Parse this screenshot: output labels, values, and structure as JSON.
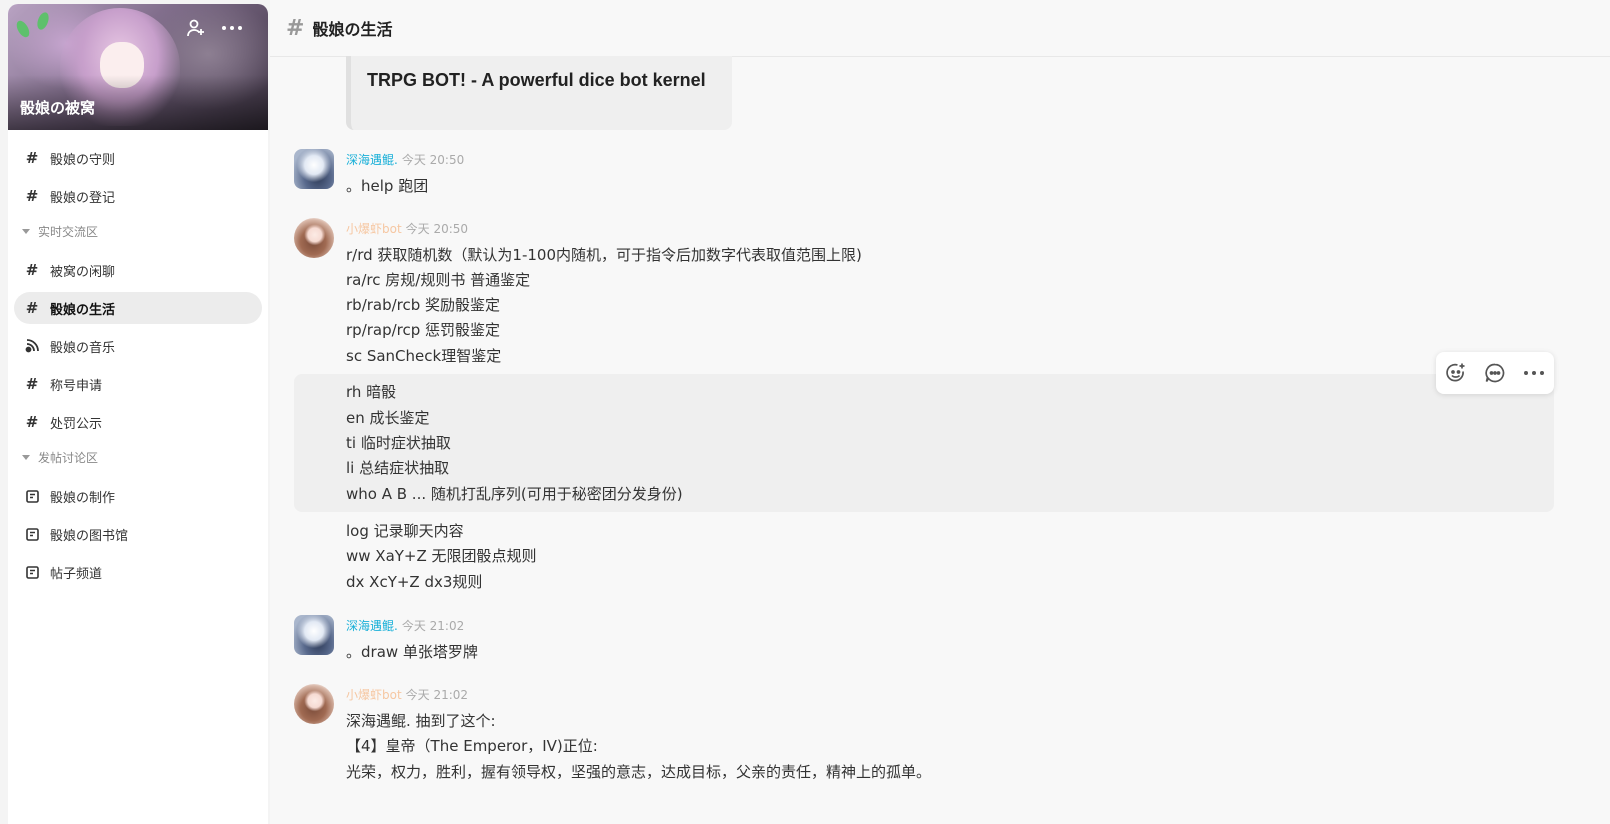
{
  "server": {
    "name": "骰娘の被窝"
  },
  "sidebar": {
    "channels_top": [
      {
        "label": "骰娘の守则",
        "icon": "hash-icon"
      },
      {
        "label": "骰娘の登记",
        "icon": "hash-icon"
      }
    ],
    "category_realtime": "实时交流区",
    "channels_realtime": [
      {
        "label": "被窝の闲聊",
        "icon": "hash-icon"
      },
      {
        "label": "骰娘の生活",
        "icon": "hash-icon",
        "active": true
      },
      {
        "label": "骰娘の音乐",
        "icon": "music-icon"
      },
      {
        "label": "称号申请",
        "icon": "hash-icon"
      },
      {
        "label": "处罚公示",
        "icon": "hash-icon"
      }
    ],
    "category_forum": "发帖讨论区",
    "channels_forum": [
      {
        "label": "骰娘の制作",
        "icon": "post-icon"
      },
      {
        "label": "骰娘の图书馆",
        "icon": "post-icon"
      },
      {
        "label": "帖子频道",
        "icon": "post-icon"
      }
    ]
  },
  "header": {
    "channel_name": "骰娘の生活"
  },
  "embed": {
    "title": "TRPG BOT! - A powerful dice bot kernel"
  },
  "messages": [
    {
      "author": "深海遇鲲.",
      "time": "今天 20:50",
      "lines": [
        "。help 跑团"
      ]
    },
    {
      "author": "小爆虾bot",
      "time": "今天 20:50",
      "lines": [
        "r/rd 获取随机数（默认为1-100内随机，可于指令后加数字代表取值范围上限)",
        "ra/rc 房规/规则书 普通鉴定",
        "rb/rab/rcb 奖励骰鉴定",
        "rp/rap/rcp 惩罚骰鉴定",
        "sc SanCheck理智鉴定",
        "rh 暗骰",
        "en 成长鉴定",
        "ti 临时症状抽取",
        "li 总结症状抽取",
        "who A B ... 随机打乱序列(可用于秘密团分发身份)",
        "log 记录聊天内容",
        "ww XaY+Z 无限团骰点规则",
        "dx XcY+Z dx3规则"
      ]
    },
    {
      "author": "深海遇鲲.",
      "time": "今天 21:02",
      "lines": [
        "。draw 单张塔罗牌"
      ]
    },
    {
      "author": "小爆虾bot",
      "time": "今天 21:02",
      "lines": [
        "深海遇鲲. 抽到了这个:",
        "【4】皇帝（The Emperor，IV)正位:",
        "光荣，权力，胜利，握有领导权，坚强的意志，达成目标，父亲的责任，精神上的孤单。"
      ]
    }
  ],
  "colors": {
    "user_name": "#1ab0d8",
    "bot_name": "#f6c7a2",
    "active_channel_bg": "#ececec"
  }
}
